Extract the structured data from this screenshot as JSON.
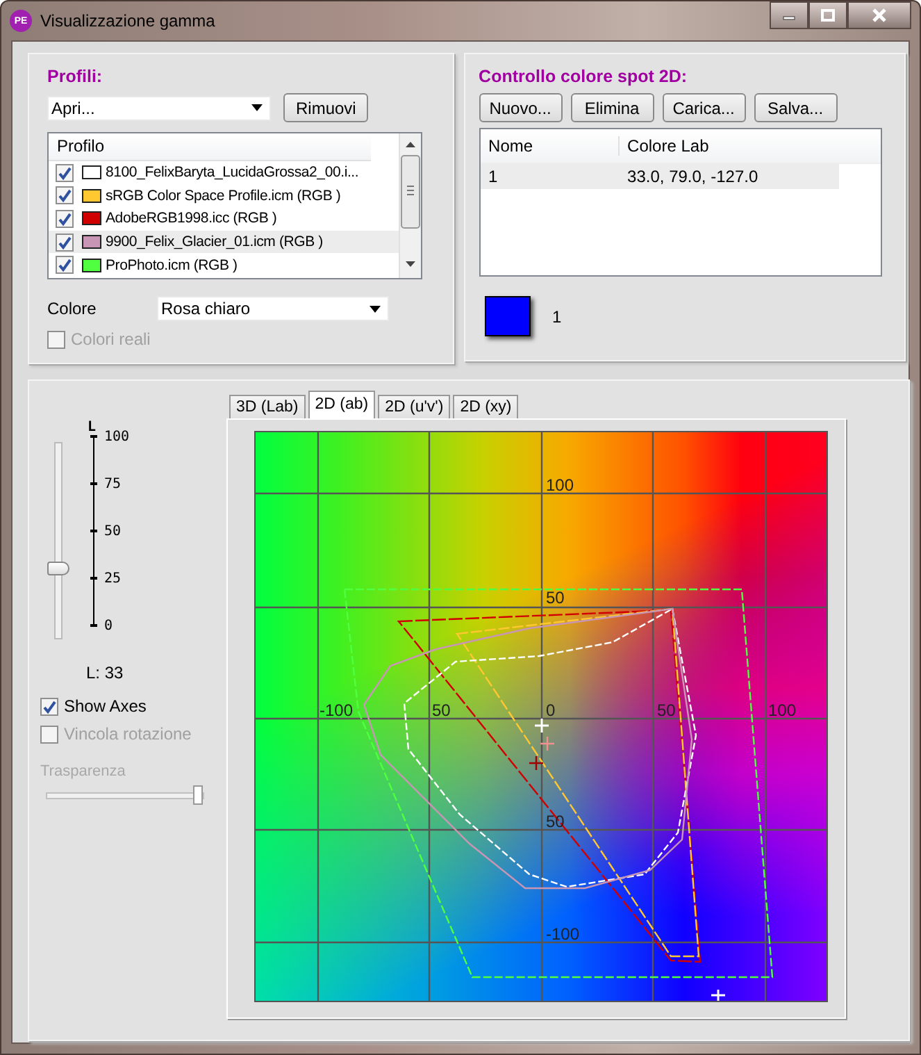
{
  "window": {
    "title": "Visualizzazione gamma",
    "icon_text": "PE"
  },
  "profiles_panel": {
    "title": "Profili:",
    "open_dropdown": {
      "value": "Apri..."
    },
    "remove_button": "Rimuovi",
    "list_header": "Profilo",
    "profiles": [
      {
        "name": "8100_FelixBaryta_LucidaGrossa2_00.i...",
        "checked": true,
        "color": "#ffffff",
        "selected": false
      },
      {
        "name": "sRGB Color Space Profile.icm (RGB )",
        "checked": true,
        "color": "#ffc830",
        "selected": false
      },
      {
        "name": "AdobeRGB1998.icc (RGB )",
        "checked": true,
        "color": "#d00000",
        "selected": false
      },
      {
        "name": "9900_Felix_Glacier_01.icm (RGB )",
        "checked": true,
        "color": "#c896b4",
        "selected": true
      },
      {
        "name": "ProPhoto.icm (RGB )",
        "checked": true,
        "color": "#50ff40",
        "selected": false
      }
    ],
    "color_label": "Colore",
    "color_dropdown": {
      "value": "Rosa chiaro"
    },
    "real_colors": {
      "label": "Colori reali",
      "checked": false,
      "disabled": true
    }
  },
  "spot_panel": {
    "title": "Controllo colore spot 2D:",
    "buttons": [
      "Nuovo...",
      "Elimina",
      "Carica...",
      "Salva..."
    ],
    "columns": [
      "Nome",
      "Colore Lab"
    ],
    "rows": [
      {
        "name": "1",
        "lab": "33.0, 79.0, -127.0",
        "selected": true
      }
    ],
    "swatches": [
      {
        "label": "1",
        "color": "#0000ff"
      }
    ]
  },
  "view_panel": {
    "lightness": {
      "title": "L",
      "ticks": [
        "100",
        "75",
        "50",
        "25",
        "0"
      ],
      "level": 0.33,
      "reading": "L: 33"
    },
    "show_axes": {
      "label": "Show Axes",
      "checked": true,
      "disabled": false
    },
    "lock_rotation": {
      "label": "Vincola rotazione",
      "checked": false,
      "disabled": true
    },
    "transparency": {
      "label": "Trasparenza",
      "level": 1,
      "disabled": true
    },
    "tabs": [
      {
        "label": "3D (Lab)",
        "selected": false
      },
      {
        "label": "2D (ab)",
        "selected": true
      },
      {
        "label": "2D (u'v')",
        "selected": false
      },
      {
        "label": "2D (xy)",
        "selected": false
      }
    ],
    "axis_labels": [
      "100",
      "50",
      "-100",
      "50",
      "0",
      "50",
      "100",
      "50",
      "-100"
    ]
  }
}
